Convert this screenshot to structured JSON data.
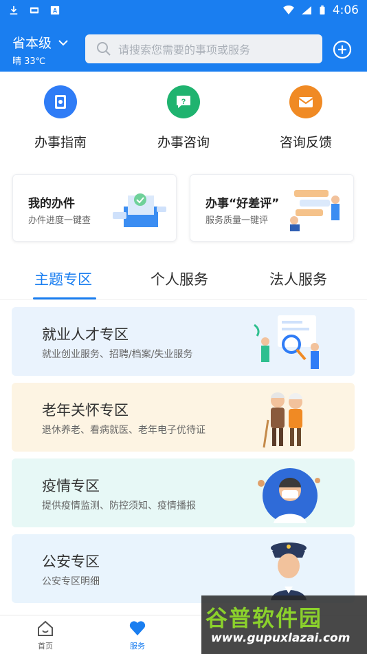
{
  "status_bar": {
    "time": "4:06",
    "icons": [
      "download-icon",
      "sim-icon",
      "a-icon",
      "wifi-icon",
      "signal-icon",
      "battery-icon"
    ]
  },
  "header": {
    "region": "省本级",
    "weather": "晴 33℃",
    "search_placeholder": "请搜索您需要的事项或服务"
  },
  "quick_actions": [
    {
      "label": "办事指南",
      "icon": "guide-book-icon",
      "color": "#2f7cf6"
    },
    {
      "label": "办事咨询",
      "icon": "question-chat-icon",
      "color": "#1fb36f"
    },
    {
      "label": "咨询反馈",
      "icon": "mail-icon",
      "color": "#f08a24"
    }
  ],
  "cards": [
    {
      "title": "我的办件",
      "subtitle": "办件进度一键查"
    },
    {
      "title": "办事“好差评”",
      "subtitle": "服务质量一键评"
    }
  ],
  "tabs": [
    {
      "label": "主题专区",
      "active": true
    },
    {
      "label": "个人服务",
      "active": false
    },
    {
      "label": "法人服务",
      "active": false
    }
  ],
  "zones": [
    {
      "title": "就业人才专区",
      "subtitle": "就业创业服务、招聘/档案/失业服务",
      "bg": "#eaf3fd"
    },
    {
      "title": "老年关怀专区",
      "subtitle": "退休养老、看病就医、老年电子优待证",
      "bg": "#fdf4e3"
    },
    {
      "title": "疫情专区",
      "subtitle": "提供疫情监测、防控须知、疫情播报",
      "bg": "#e7f8f6"
    },
    {
      "title": "公安专区",
      "subtitle": "公安专区明细",
      "bg": "#e9f4fd"
    }
  ],
  "bottom_nav": [
    {
      "label": "首页",
      "active": false
    },
    {
      "label": "服务",
      "active": true
    }
  ],
  "watermark": {
    "title": "谷普软件园",
    "url": "www.gupuxlazai.com"
  },
  "colors": {
    "primary": "#1a7ef0"
  }
}
